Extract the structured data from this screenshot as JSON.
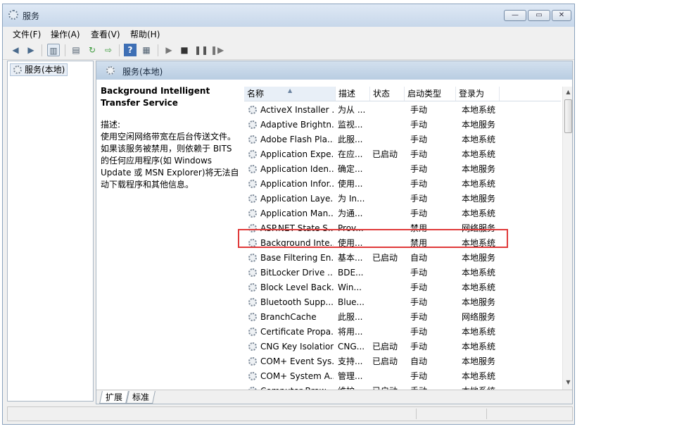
{
  "window": {
    "title": "服务",
    "buttons": {
      "minimize": "—",
      "maximize": "▭",
      "close": "✕"
    }
  },
  "menu": [
    "文件(F)",
    "操作(A)",
    "查看(V)",
    "帮助(H)"
  ],
  "toolbar": {
    "icons": [
      "back-arrow-icon",
      "forward-arrow-icon",
      "console-tree-icon",
      "properties-icon",
      "refresh-icon",
      "export-list-icon",
      "help-icon",
      "action-pane-icon",
      "start-service-icon",
      "stop-service-icon",
      "pause-service-icon",
      "restart-service-icon"
    ]
  },
  "tree": {
    "root": "服务(本地)"
  },
  "pane": {
    "header": "服务(本地)"
  },
  "description": {
    "title": "Background Intelligent Transfer Service",
    "label": "描述:",
    "body": "使用空闲网络带宽在后台传送文件。如果该服务被禁用，则依赖于 BITS 的任何应用程序(如 Windows Update 或 MSN Explorer)将无法自动下载程序和其他信息。"
  },
  "columns": [
    "名称",
    "描述",
    "状态",
    "启动类型",
    "登录为"
  ],
  "rows": [
    [
      "ActiveX Installer ...",
      "为从 ...",
      "",
      "手动",
      "本地系统"
    ],
    [
      "Adaptive Brightn...",
      "监视...",
      "",
      "手动",
      "本地服务"
    ],
    [
      "Adobe Flash Pla...",
      "此服...",
      "",
      "手动",
      "本地系统"
    ],
    [
      "Application Expe...",
      "在应...",
      "已启动",
      "手动",
      "本地系统"
    ],
    [
      "Application Iden...",
      "确定...",
      "",
      "手动",
      "本地服务"
    ],
    [
      "Application Infor...",
      "使用...",
      "",
      "手动",
      "本地系统"
    ],
    [
      "Application Laye...",
      "为 In...",
      "",
      "手动",
      "本地服务"
    ],
    [
      "Application Man...",
      "为通...",
      "",
      "手动",
      "本地系统"
    ],
    [
      "ASP.NET State S...",
      "Prov...",
      "",
      "禁用",
      "网络服务"
    ],
    [
      "Background Inte...",
      "使用...",
      "",
      "禁用",
      "本地系统"
    ],
    [
      "Base Filtering En...",
      "基本...",
      "已启动",
      "自动",
      "本地服务"
    ],
    [
      "BitLocker Drive ...",
      "BDE...",
      "",
      "手动",
      "本地系统"
    ],
    [
      "Block Level Back...",
      "Win...",
      "",
      "手动",
      "本地系统"
    ],
    [
      "Bluetooth Supp...",
      "Blue...",
      "",
      "手动",
      "本地服务"
    ],
    [
      "BranchCache",
      "此服...",
      "",
      "手动",
      "网络服务"
    ],
    [
      "Certificate Propa...",
      "将用...",
      "",
      "手动",
      "本地系统"
    ],
    [
      "CNG Key Isolation",
      "CNG...",
      "已启动",
      "手动",
      "本地系统"
    ],
    [
      "COM+ Event Sys...",
      "支持...",
      "已启动",
      "自动",
      "本地服务"
    ],
    [
      "COM+ System A...",
      "管理...",
      "",
      "手动",
      "本地系统"
    ],
    [
      "Computer Brow...",
      "维护...",
      "已启动",
      "手动",
      "本地系统"
    ]
  ],
  "tabs": [
    "扩展",
    "标准"
  ]
}
